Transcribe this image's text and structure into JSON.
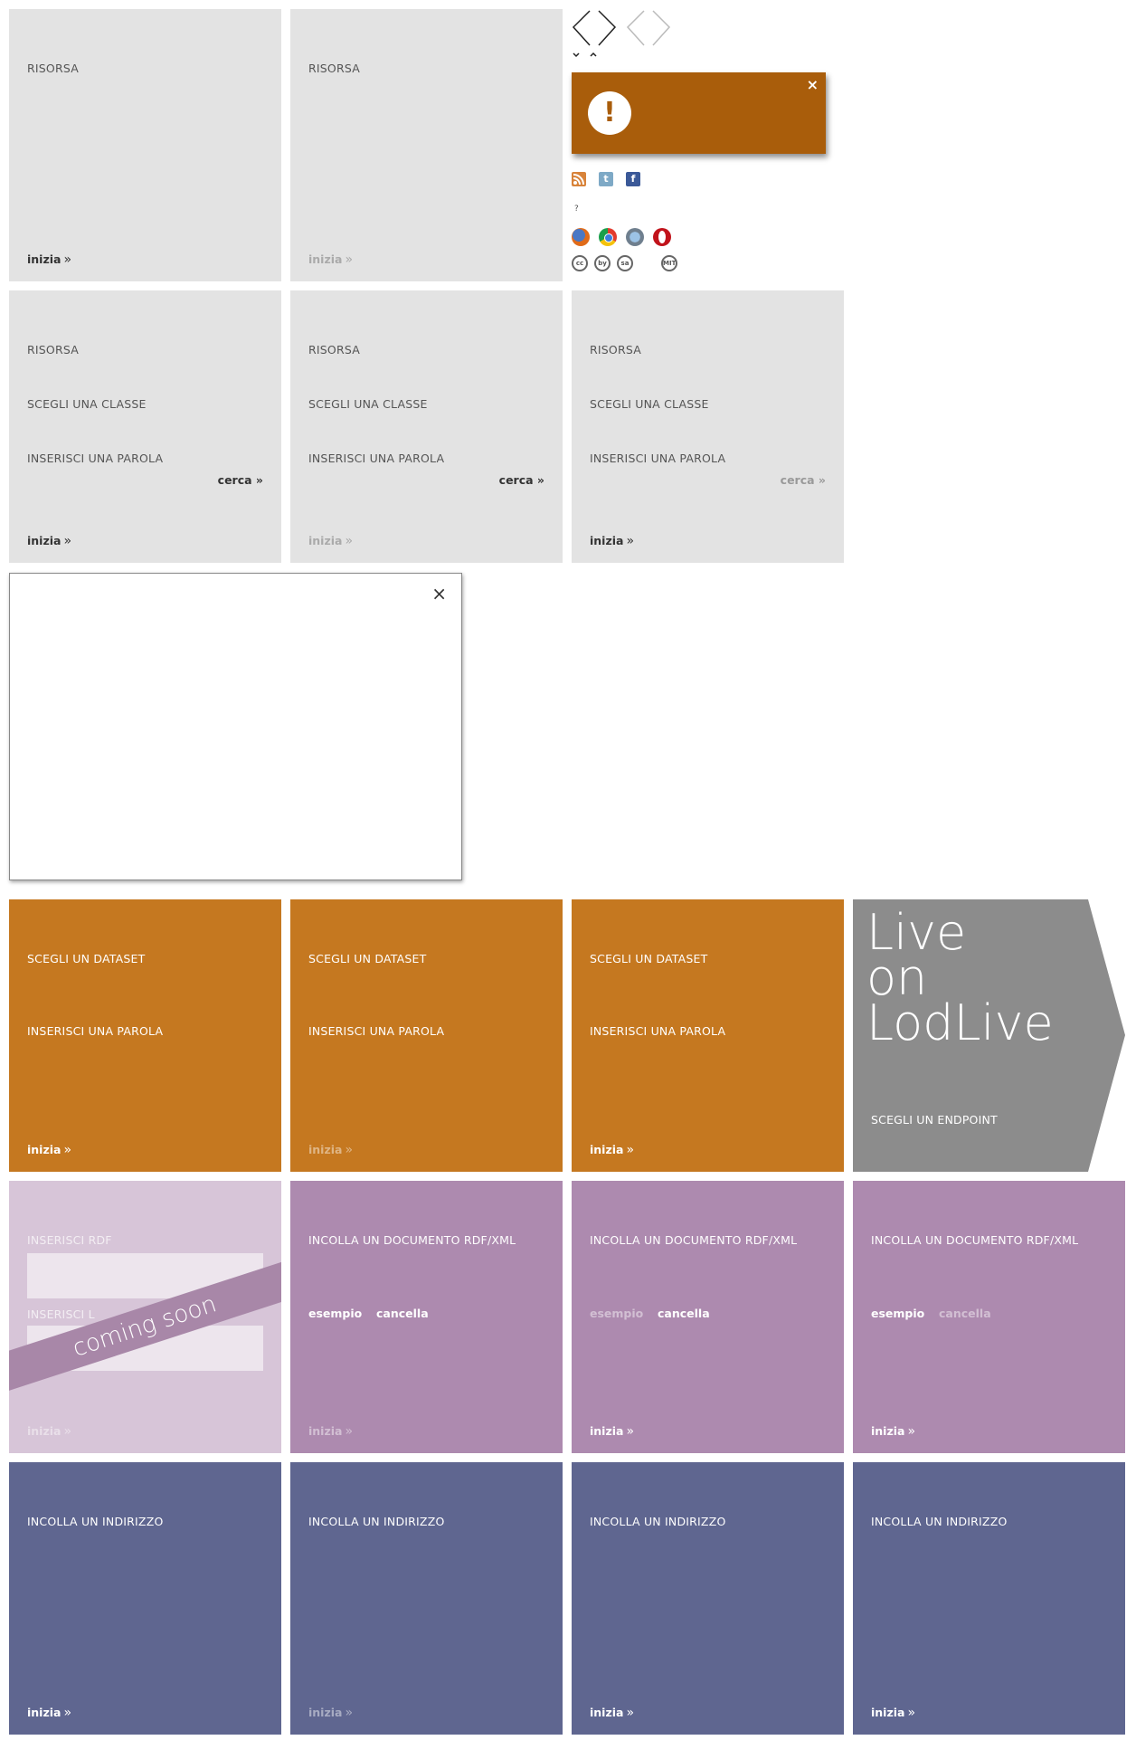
{
  "labels": {
    "risorsa": "RISORSA",
    "scegli_classe": "SCEGLI UNA CLASSE",
    "inserisci_parola": "INSERISCI UNA PAROLA",
    "scegli_dataset": "SCEGLI UN DATASET",
    "scegli_endpoint": "SCEGLI UN ENDPOINT",
    "inserisci_rdf": "INSERISCI RDF",
    "inserisci_rdf_2": "INSERISCI L",
    "incolla_rdf": "INCOLLA UN DOCUMENTO RDF/XML",
    "incolla_indirizzo": "INCOLLA UN INDIRIZZO"
  },
  "actions": {
    "inizia": "inizia",
    "arrow": "»",
    "cerca": "cerca",
    "esempio": "esempio",
    "cancella": "cancella"
  },
  "banner": {
    "coming_soon": "coming soon"
  },
  "lodlive": {
    "line1": "Live",
    "line2": "on",
    "line3": "LodLive"
  },
  "notification": {
    "close": "×",
    "icon": "!"
  },
  "dialog": {
    "close": "×"
  },
  "nav": {
    "prev": "<",
    "next": ">",
    "down": "ˇ",
    "up": "ˆ"
  },
  "social": {
    "rss": "rss-icon",
    "twitter": "t",
    "facebook": "f"
  },
  "help": "?",
  "licenses": {
    "cc": "cc",
    "by": "by",
    "sa": "sa",
    "mit": "MIT"
  },
  "colors": {
    "grey": "#e3e3e3",
    "orange": "#c57820",
    "purple": "#ad8aaf",
    "blue": "#5f6690",
    "notification": "#a95d0b",
    "endpoint": "#8c8c8c"
  }
}
